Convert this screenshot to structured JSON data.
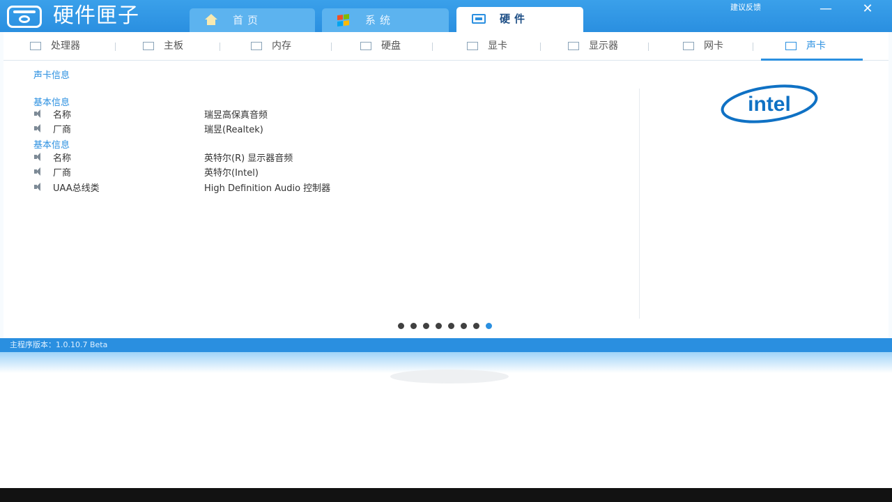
{
  "app": {
    "name": "硬件匣子",
    "feedback_label": "建议反馈",
    "minimize_label": "—",
    "close_label": "✕"
  },
  "tabs": [
    {
      "label": "首页",
      "icon": "home-icon",
      "active": false
    },
    {
      "label": "系统",
      "icon": "windows-icon",
      "active": false
    },
    {
      "label": "硬件",
      "icon": "hardware-icon",
      "active": true
    }
  ],
  "subtabs": [
    {
      "label": "处理器",
      "icon": "cpu-icon",
      "active": false
    },
    {
      "label": "主板",
      "icon": "motherboard-icon",
      "active": false
    },
    {
      "label": "内存",
      "icon": "memory-icon",
      "active": false
    },
    {
      "label": "硬盘",
      "icon": "disk-icon",
      "active": false
    },
    {
      "label": "显卡",
      "icon": "gpu-icon",
      "active": false
    },
    {
      "label": "显示器",
      "icon": "monitor-icon",
      "active": false
    },
    {
      "label": "网卡",
      "icon": "network-icon",
      "active": false
    },
    {
      "label": "声卡",
      "icon": "speaker-icon",
      "active": true
    }
  ],
  "content": {
    "section_title": "声卡信息",
    "groups": [
      {
        "title": "基本信息",
        "rows": [
          {
            "key": "名称",
            "value": "瑞昱高保真音频"
          },
          {
            "key": "厂商",
            "value": "瑞昱(Realtek)"
          }
        ]
      },
      {
        "title": "基本信息",
        "rows": [
          {
            "key": "名称",
            "value": "英特尔(R) 显示器音频"
          },
          {
            "key": "厂商",
            "value": "英特尔(Intel)"
          },
          {
            "key": "UAA总线类",
            "value": "High Definition Audio 控制器"
          }
        ]
      }
    ],
    "brand_logo_text": "intel"
  },
  "pager": {
    "total": 8,
    "current": 8
  },
  "status": {
    "version_text": "主程序版本：1.0.10.7 Beta"
  },
  "colors": {
    "accent": "#2a8fe0",
    "titlebar": "#3aa0ea",
    "intel_blue": "#0f71c4"
  }
}
